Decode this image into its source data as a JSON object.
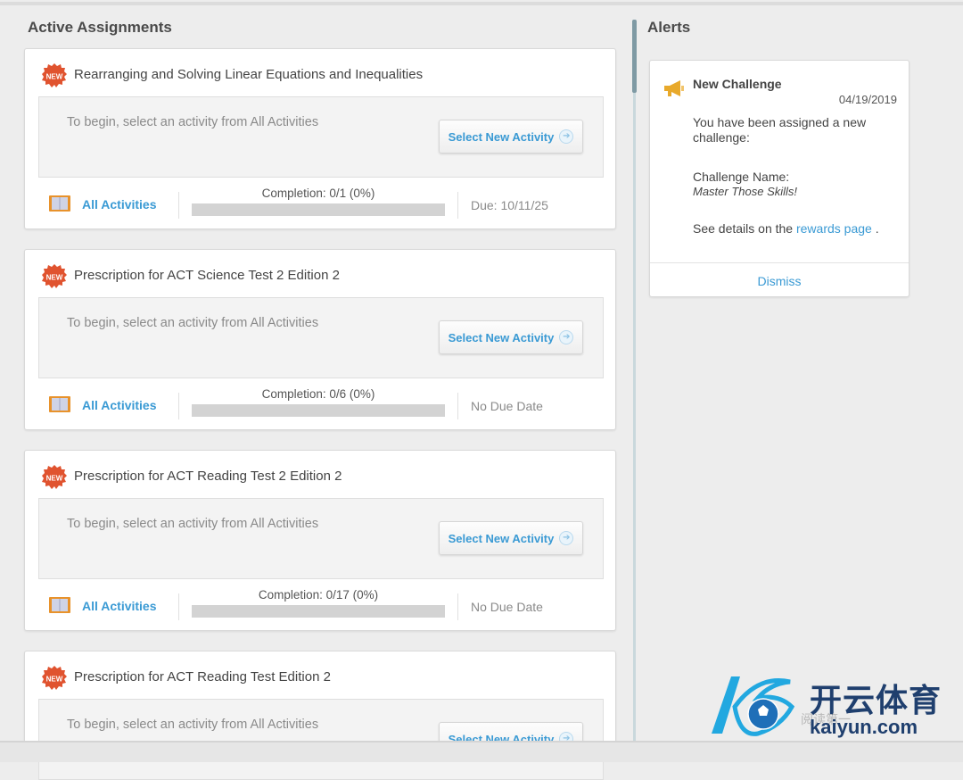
{
  "sections": {
    "active_title": "Active Assignments",
    "alerts_title": "Alerts"
  },
  "assignments": [
    {
      "title": "Rearranging and Solving Linear Equations and Inequalities",
      "hint": "To begin, select an activity from All Activities",
      "button": "Select New Activity",
      "all_activities": "All Activities",
      "completion": "Completion: 0/1 (0%)",
      "progress": 0,
      "due": "Due: 10/11/25"
    },
    {
      "title": "Prescription for ACT Science Test 2 Edition 2",
      "hint": "To begin, select an activity from All Activities",
      "button": "Select New Activity",
      "all_activities": "All Activities",
      "completion": "Completion: 0/6 (0%)",
      "progress": 0,
      "due": "No Due Date"
    },
    {
      "title": "Prescription for ACT Reading Test 2 Edition 2",
      "hint": "To begin, select an activity from All Activities",
      "button": "Select New Activity",
      "all_activities": "All Activities",
      "completion": "Completion: 0/17 (0%)",
      "progress": 0,
      "due": "No Due Date"
    },
    {
      "title": "Prescription for ACT Reading Test Edition 2",
      "hint": "To begin, select an activity from All Activities",
      "button": "Select New Activity"
    }
  ],
  "alert": {
    "heading": "New Challenge",
    "date": "04/19/2019",
    "message": "You have been assigned a new challenge:",
    "name_label": "Challenge Name:",
    "name": "Master Those Skills!",
    "details_prefix": "See details on the",
    "details_link": "rewards page",
    "details_suffix": ".",
    "dismiss": "Dismiss"
  },
  "badge_icon": "new-badge-icon",
  "book_icon": "book-icon",
  "alert_icon": "megaphone-icon",
  "colors": {
    "link": "#3a9ad4",
    "badge": "#e0532f",
    "book": "#e8922b",
    "megaphone": "#e8a92b"
  },
  "watermark": {
    "brand": "开云体育",
    "url": "kaiyun.com",
    "sub": "阅读第一"
  }
}
